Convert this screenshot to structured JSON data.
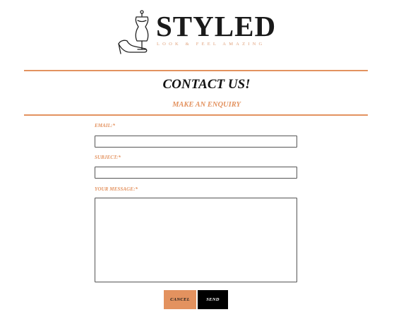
{
  "brand": {
    "name": "STYLED",
    "tagline": "LOOK & FEEL AMAZING",
    "logo_icon": "dress-form-and-heel-icon"
  },
  "header": {
    "title": "CONTACT US!",
    "subtitle": "MAKE AN ENQUIRY"
  },
  "form": {
    "email_label": "EMAIL:*",
    "email_value": "",
    "subject_label": "SUBJECT:*",
    "subject_value": "",
    "message_label": "YOUR MESSAGE:*",
    "message_value": "",
    "cancel_label": "CANCEL",
    "send_label": "SEND"
  },
  "colors": {
    "accent": "#e3925f",
    "text": "#111111",
    "send_button": "#000000"
  }
}
